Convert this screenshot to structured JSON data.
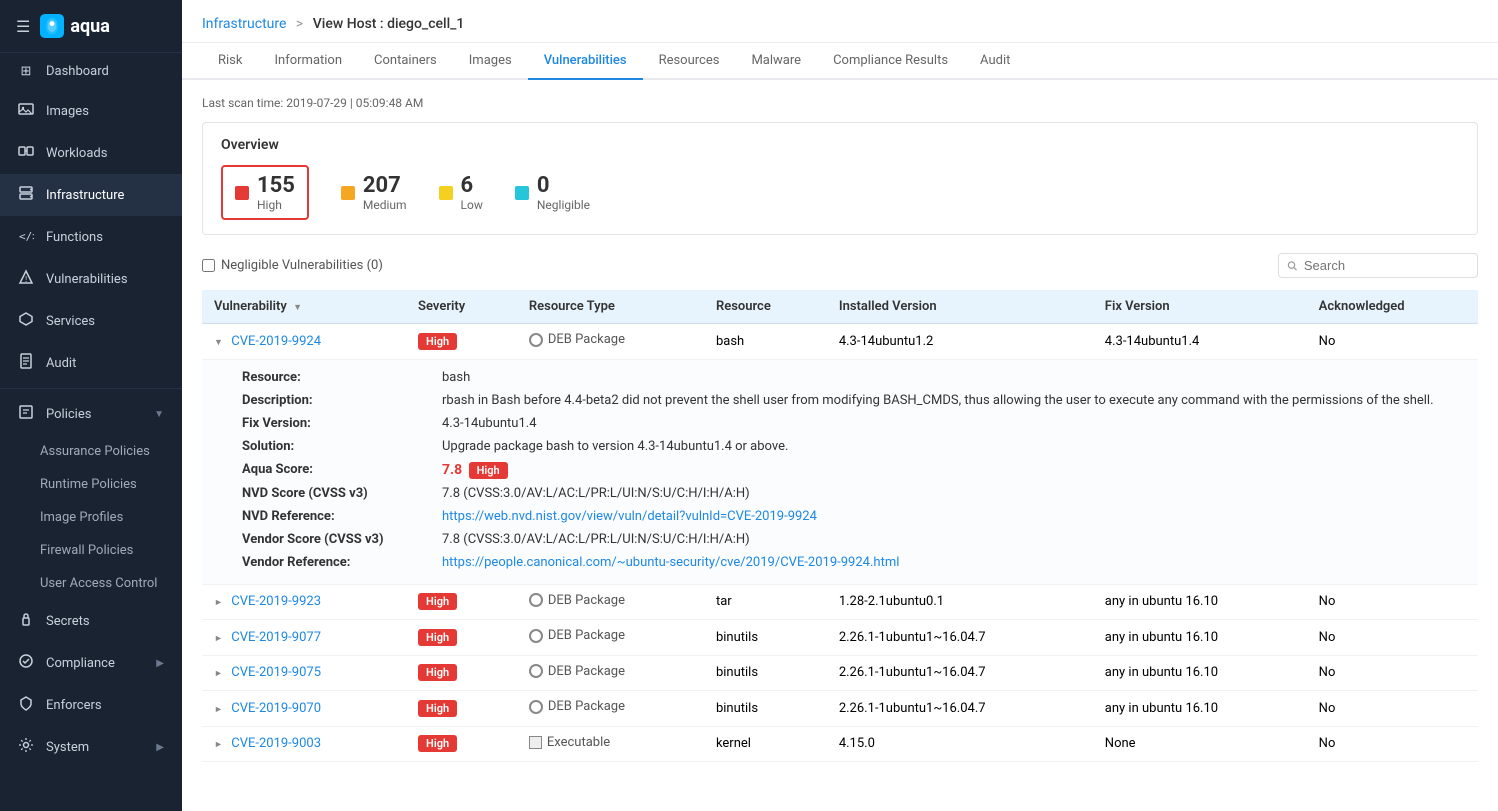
{
  "sidebar": {
    "logo": "aqua",
    "hamburger": "☰",
    "items": [
      {
        "id": "dashboard",
        "label": "Dashboard",
        "icon": "⊞"
      },
      {
        "id": "images",
        "label": "Images",
        "icon": "🖼"
      },
      {
        "id": "workloads",
        "label": "Workloads",
        "icon": "⚙"
      },
      {
        "id": "infrastructure",
        "label": "Infrastructure",
        "icon": "🏗",
        "active": true
      },
      {
        "id": "functions",
        "label": "Functions",
        "icon": "</>"
      },
      {
        "id": "vulnerabilities",
        "label": "Vulnerabilities",
        "icon": "⚠"
      },
      {
        "id": "services",
        "label": "Services",
        "icon": "⬡"
      },
      {
        "id": "audit",
        "label": "Audit",
        "icon": "📋"
      },
      {
        "id": "policies",
        "label": "Policies",
        "icon": "📄",
        "hasArrow": true
      },
      {
        "id": "assurance-policies",
        "label": "Assurance Policies",
        "sub": true
      },
      {
        "id": "runtime-policies",
        "label": "Runtime Policies",
        "sub": true
      },
      {
        "id": "image-profiles",
        "label": "Image Profiles",
        "sub": true
      },
      {
        "id": "firewall-policies",
        "label": "Firewall Policies",
        "sub": true
      },
      {
        "id": "user-access-control",
        "label": "User Access Control",
        "sub": true
      },
      {
        "id": "secrets",
        "label": "Secrets",
        "icon": "🔑"
      },
      {
        "id": "compliance",
        "label": "Compliance",
        "icon": "✓",
        "hasArrow": true
      },
      {
        "id": "enforcers",
        "label": "Enforcers",
        "icon": "🛡"
      },
      {
        "id": "system",
        "label": "System",
        "icon": "⚙",
        "hasArrow": true
      }
    ]
  },
  "breadcrumb": {
    "parent": "Infrastructure",
    "separator": ">",
    "current": "View Host : diego_cell_1"
  },
  "tabs": [
    {
      "id": "risk",
      "label": "Risk"
    },
    {
      "id": "information",
      "label": "Information"
    },
    {
      "id": "containers",
      "label": "Containers"
    },
    {
      "id": "images",
      "label": "Images"
    },
    {
      "id": "vulnerabilities",
      "label": "Vulnerabilities",
      "active": true
    },
    {
      "id": "resources",
      "label": "Resources"
    },
    {
      "id": "malware",
      "label": "Malware"
    },
    {
      "id": "compliance-results",
      "label": "Compliance Results"
    },
    {
      "id": "audit",
      "label": "Audit"
    }
  ],
  "scan_time": "Last scan time: 2019-07-29 | 05:09:48 AM",
  "overview": {
    "title": "Overview",
    "stats": [
      {
        "id": "high",
        "count": "155",
        "label": "High",
        "color": "high",
        "selected": true
      },
      {
        "id": "medium",
        "count": "207",
        "label": "Medium",
        "color": "medium"
      },
      {
        "id": "low",
        "count": "6",
        "label": "Low",
        "color": "low"
      },
      {
        "id": "negligible",
        "count": "0",
        "label": "Negligible",
        "color": "negligible"
      }
    ]
  },
  "filter": {
    "negligible_label": "Negligible Vulnerabilities (0)"
  },
  "search": {
    "placeholder": "Search"
  },
  "table": {
    "headers": [
      {
        "id": "vulnerability",
        "label": "Vulnerability",
        "sortable": true
      },
      {
        "id": "severity",
        "label": "Severity"
      },
      {
        "id": "resource-type",
        "label": "Resource Type"
      },
      {
        "id": "resource",
        "label": "Resource"
      },
      {
        "id": "installed-version",
        "label": "Installed Version"
      },
      {
        "id": "fix-version",
        "label": "Fix Version"
      },
      {
        "id": "acknowledged",
        "label": "Acknowledged"
      }
    ],
    "expanded_row": {
      "cve": "CVE-2019-9924",
      "severity": "High",
      "resource_type": "DEB Package",
      "resource": "bash",
      "installed_version": "4.3-14ubuntu1.2",
      "fix_version": "4.3-14ubuntu1.4",
      "acknowledged": "No",
      "details": {
        "resource_label": "Resource:",
        "resource_value": "bash",
        "description_label": "Description:",
        "description_value": "rbash in Bash before 4.4-beta2 did not prevent the shell user from modifying BASH_CMDS, thus allowing the user to execute any command with the permissions of the shell.",
        "fix_version_label": "Fix Version:",
        "fix_version_value": "4.3-14ubuntu1.4",
        "solution_label": "Solution:",
        "solution_value": "Upgrade package bash to version 4.3-14ubuntu1.4 or above.",
        "aqua_score_label": "Aqua Score:",
        "aqua_score_value": "7.8",
        "aqua_score_badge": "High",
        "nvd_score_label": "NVD Score (CVSS v3)",
        "nvd_score_value": "7.8  (CVSS:3.0/AV:L/AC:L/PR:L/UI:N/S:U/C:H/I:H/A:H)",
        "nvd_reference_label": "NVD Reference:",
        "nvd_reference_url": "https://web.nvd.nist.gov/view/vuln/detail?vulnId=CVE-2019-9924",
        "vendor_score_label": "Vendor Score (CVSS v3)",
        "vendor_score_value": "7.8  (CVSS:3.0/AV:L/AC:L/PR:L/UI:N/S:U/C:H/I:H/A:H)",
        "vendor_reference_label": "Vendor Reference:",
        "vendor_reference_url": "https://people.canonical.com/~ubuntu-security/cve/2019/CVE-2019-9924.html"
      }
    },
    "rows": [
      {
        "cve": "CVE-2019-9923",
        "severity": "High",
        "resource_type": "DEB Package",
        "resource": "tar",
        "installed_version": "1.28-2.1ubuntu0.1",
        "fix_version": "any in ubuntu 16.10",
        "acknowledged": "No"
      },
      {
        "cve": "CVE-2019-9077",
        "severity": "High",
        "resource_type": "DEB Package",
        "resource": "binutils",
        "installed_version": "2.26.1-1ubuntu1~16.04.7",
        "fix_version": "any in ubuntu 16.10",
        "acknowledged": "No"
      },
      {
        "cve": "CVE-2019-9075",
        "severity": "High",
        "resource_type": "DEB Package",
        "resource": "binutils",
        "installed_version": "2.26.1-1ubuntu1~16.04.7",
        "fix_version": "any in ubuntu 16.10",
        "acknowledged": "No"
      },
      {
        "cve": "CVE-2019-9070",
        "severity": "High",
        "resource_type": "DEB Package",
        "resource": "binutils",
        "installed_version": "2.26.1-1ubuntu1~16.04.7",
        "fix_version": "any in ubuntu 16.10",
        "acknowledged": "No"
      },
      {
        "cve": "CVE-2019-9003",
        "severity": "High",
        "resource_type": "Executable",
        "resource": "kernel",
        "installed_version": "4.15.0",
        "fix_version": "None",
        "acknowledged": "No"
      }
    ]
  }
}
